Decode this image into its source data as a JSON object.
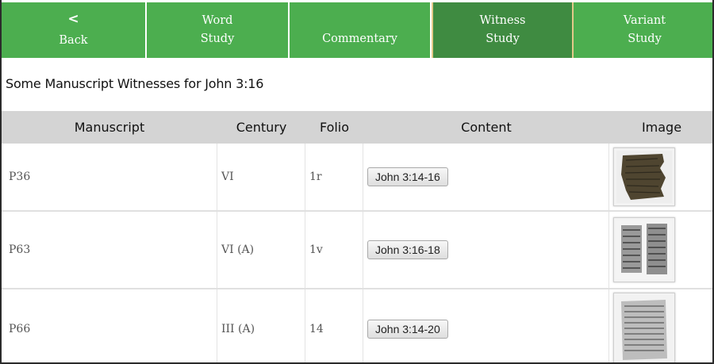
{
  "nav": {
    "back": {
      "icon": "<",
      "label": "Back"
    },
    "word_study": {
      "line1": "Word",
      "line2": "Study"
    },
    "commentary": {
      "label": "Commentary"
    },
    "witness_study": {
      "line1": "Witness",
      "line2": "Study"
    },
    "variant_study": {
      "line1": "Variant",
      "line2": "Study"
    }
  },
  "heading": "Some Manuscript Witnesses for John 3:16",
  "table": {
    "headers": {
      "manuscript": "Manuscript",
      "century": "Century",
      "folio": "Folio",
      "content": "Content",
      "image": "Image"
    },
    "rows": [
      {
        "manuscript": "P36",
        "century": "VI",
        "folio": "1r",
        "content": "John 3:14-16"
      },
      {
        "manuscript": "P63",
        "century": "VI (A)",
        "folio": "1v",
        "content": "John 3:16-18"
      },
      {
        "manuscript": "P66",
        "century": "III (A)",
        "folio": "14",
        "content": "John 3:14-20"
      }
    ]
  },
  "colors": {
    "nav_green": "#4cae4f",
    "nav_active": "#3f8b41",
    "header_gray": "#d4d4d4"
  }
}
